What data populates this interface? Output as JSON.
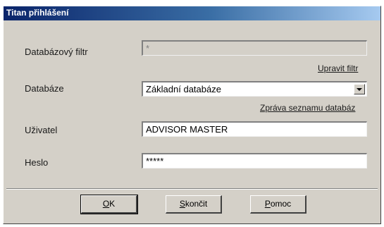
{
  "window": {
    "title": "Titan přihlášení"
  },
  "form": {
    "filter": {
      "label": "Databázový filtr",
      "value": "*"
    },
    "edit_filter_link": "Upravit filtr",
    "database": {
      "label": "Databáze",
      "value": "Základní databáze"
    },
    "db_list_link": "Zpráva seznamu databáz",
    "user": {
      "label": "Uživatel",
      "value": "ADVISOR MASTER"
    },
    "password": {
      "label": "Heslo",
      "value": "*****"
    }
  },
  "buttons": {
    "ok": {
      "accel": "O",
      "rest": "K"
    },
    "quit": {
      "accel": "S",
      "rest": "končit"
    },
    "help": {
      "accel": "P",
      "rest": "omoc"
    }
  },
  "colors": {
    "title_start": "#0a246a",
    "title_end": "#a6caf0",
    "face": "#d4d0c8"
  },
  "icons": {
    "dropdown": "chevron-down-icon"
  }
}
